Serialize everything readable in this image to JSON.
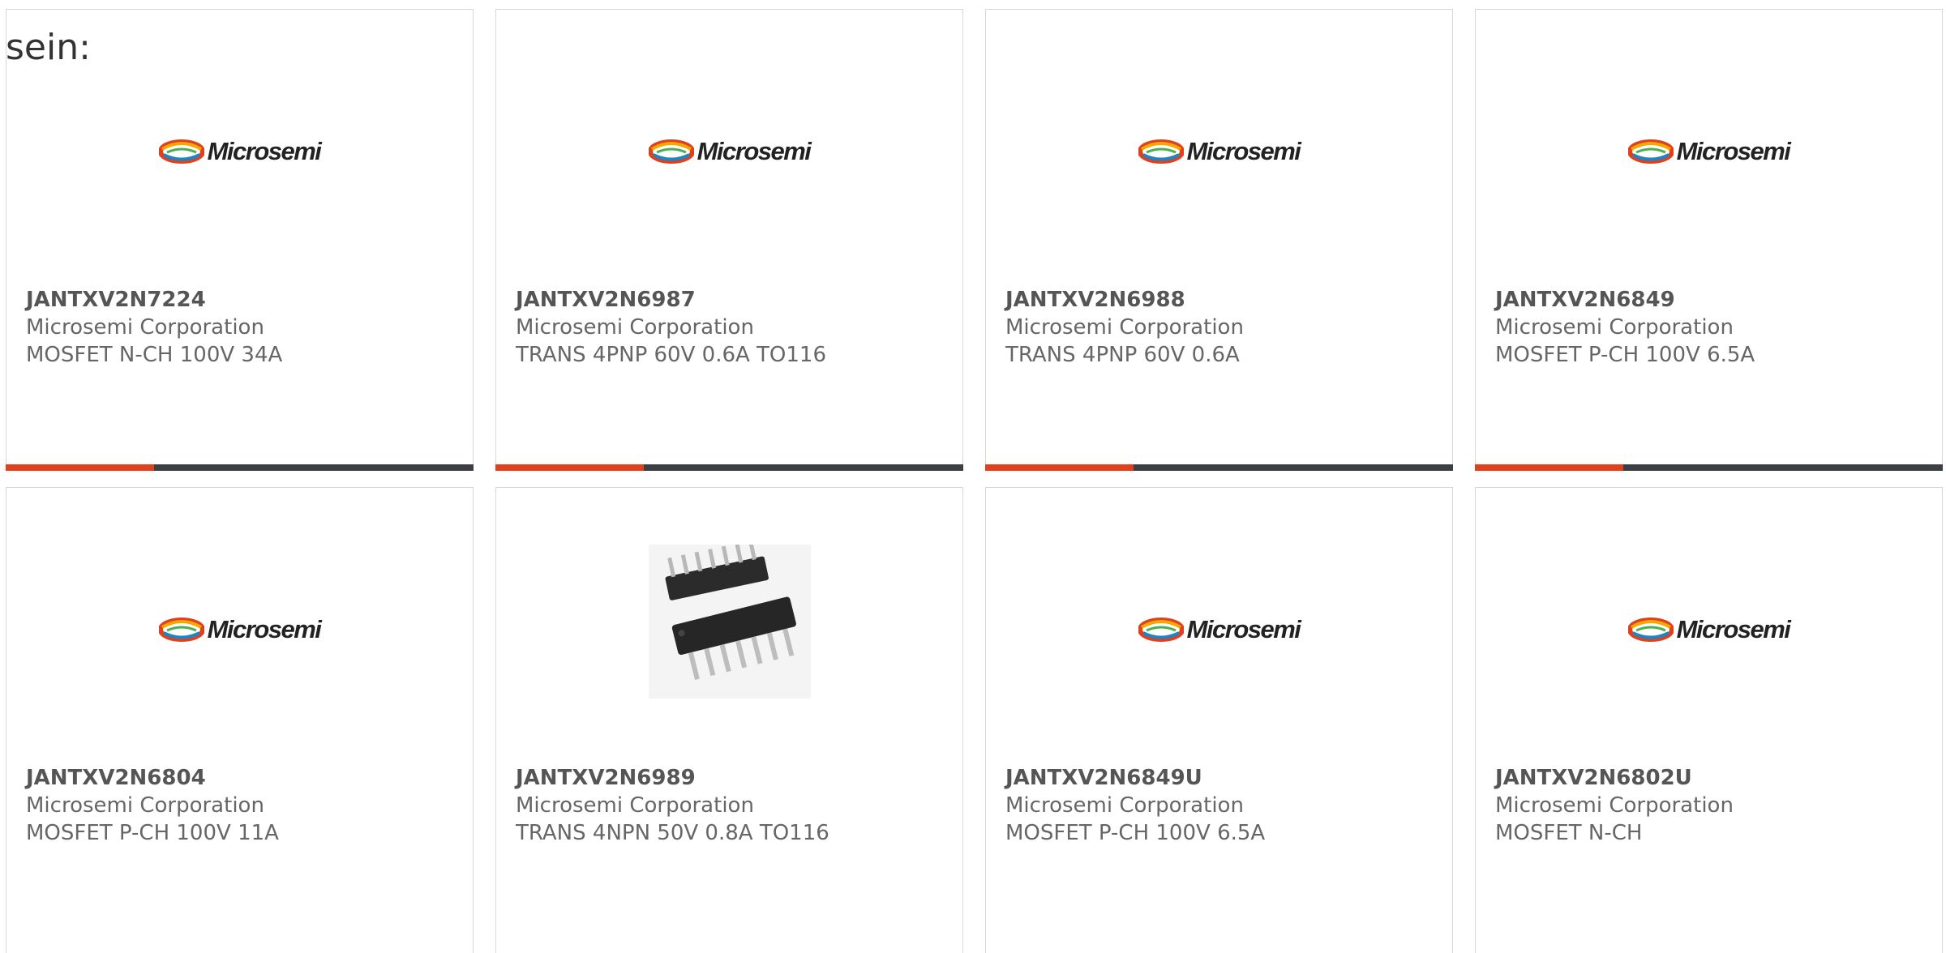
{
  "heading": "sein:",
  "brand_colors": {
    "accent": "#e0401c",
    "bar": "#3b3f43",
    "text": "#666666"
  },
  "logo_text": "Microsemi",
  "products": [
    {
      "part": "JANTXV2N7224",
      "manufacturer": "Microsemi Corporation",
      "description": "MOSFET N-CH 100V 34A",
      "image": "microsemi-logo"
    },
    {
      "part": "JANTXV2N6987",
      "manufacturer": "Microsemi Corporation",
      "description": "TRANS 4PNP 60V 0.6A TO116",
      "image": "microsemi-logo"
    },
    {
      "part": "JANTXV2N6988",
      "manufacturer": "Microsemi Corporation",
      "description": "TRANS 4PNP 60V 0.6A",
      "image": "microsemi-logo"
    },
    {
      "part": "JANTXV2N6849",
      "manufacturer": "Microsemi Corporation",
      "description": "MOSFET P-CH 100V 6.5A",
      "image": "microsemi-logo"
    },
    {
      "part": "JANTXV2N6804",
      "manufacturer": "Microsemi Corporation",
      "description": "MOSFET P-CH 100V 11A",
      "image": "microsemi-logo"
    },
    {
      "part": "JANTXV2N6989",
      "manufacturer": "Microsemi Corporation",
      "description": "TRANS 4NPN 50V 0.8A TO116",
      "image": "dip-chip-photo"
    },
    {
      "part": "JANTXV2N6849U",
      "manufacturer": "Microsemi Corporation",
      "description": "MOSFET P-CH 100V 6.5A",
      "image": "microsemi-logo"
    },
    {
      "part": "JANTXV2N6802U",
      "manufacturer": "Microsemi Corporation",
      "description": "MOSFET N-CH",
      "image": "microsemi-logo"
    }
  ]
}
